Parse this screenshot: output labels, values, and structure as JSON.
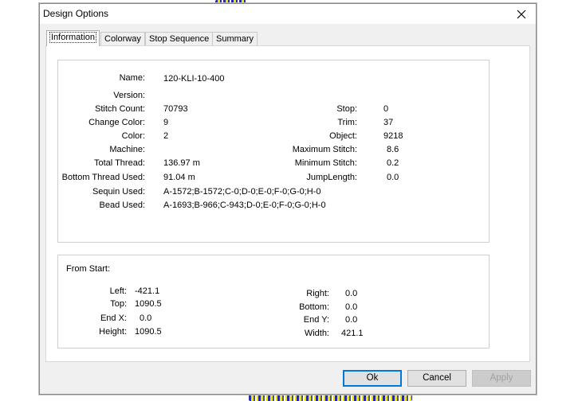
{
  "dialog": {
    "title": "Design Options",
    "close_icon": "close-icon"
  },
  "tabs": [
    {
      "label": "Information",
      "active": true
    },
    {
      "label": "Colorway",
      "active": false
    },
    {
      "label": "Stop Sequence",
      "active": false
    },
    {
      "label": "Summary",
      "active": false
    }
  ],
  "info": {
    "name_label": "Name:",
    "name_value": "120-KLI-10-400",
    "version_label": "Version:",
    "version_value": "",
    "stitch_count_label": "Stitch Count:",
    "stitch_count_value": "70793",
    "change_color_label": "Change Color:",
    "change_color_value": "9",
    "color_label": "Color:",
    "color_value": "2",
    "machine_label": "Machine:",
    "machine_value": "",
    "total_thread_label": "Total Thread:",
    "total_thread_value": "136.97 m",
    "bottom_thread_label": "Bottom Thread Used:",
    "bottom_thread_value": "91.04 m",
    "sequin_label": "Sequin Used:",
    "sequin_value": "A-1572;B-1572;C-0;D-0;E-0;F-0;G-0;H-0",
    "bead_label": "Bead Used:",
    "bead_value": "A-1693;B-966;C-943;D-0;E-0;F-0;G-0;H-0",
    "stop_label": "Stop:",
    "stop_value": "0",
    "trim_label": "Trim:",
    "trim_value": "37",
    "object_label": "Object:",
    "object_value": "9218",
    "max_stitch_label": "Maximum Stitch:",
    "max_stitch_value": "8.6",
    "min_stitch_label": "Minimum Stitch:",
    "min_stitch_value": "0.2",
    "jump_label": "JumpLength:",
    "jump_value": "0.0"
  },
  "from_start": {
    "header": "From Start:",
    "left_label": "Left:",
    "left_value": "-421.1",
    "top_label": "Top:",
    "top_value": "1090.5",
    "endx_label": "End X:",
    "endx_value": "0.0",
    "height_label": "Height:",
    "height_value": "1090.5",
    "right_label": "Right:",
    "right_value": "0.0",
    "bottom_label": "Bottom:",
    "bottom_value": "0.0",
    "endy_label": "End Y:",
    "endy_value": "0.0",
    "width_label": "Width:",
    "width_value": "421.1"
  },
  "buttons": {
    "ok": "Ok",
    "cancel": "Cancel",
    "apply": "Apply"
  }
}
